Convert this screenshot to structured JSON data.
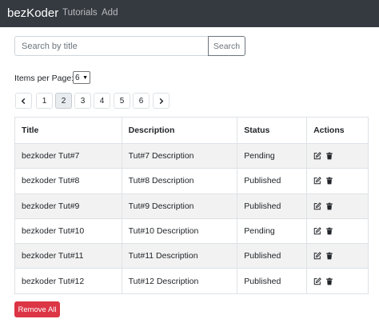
{
  "navbar": {
    "brand": "bezKoder",
    "links": [
      "Tutorials",
      "Add"
    ],
    "bg_color": "#343a40"
  },
  "search": {
    "placeholder": "Search by title",
    "value": "",
    "button_label": "Search"
  },
  "items_per_page": {
    "label": "Items per Page:",
    "selected": "6"
  },
  "pagination": {
    "prev_icon": "chevron-left-icon",
    "next_icon": "chevron-right-icon",
    "pages": [
      "1",
      "2",
      "3",
      "4",
      "5",
      "6"
    ],
    "active_page": "2"
  },
  "table": {
    "headers": [
      "Title",
      "Description",
      "Status",
      "Actions"
    ],
    "rows": [
      {
        "title": "bezkoder Tut#7",
        "description": "Tut#7 Description",
        "status": "Pending"
      },
      {
        "title": "bezkoder Tut#8",
        "description": "Tut#8 Description",
        "status": "Published"
      },
      {
        "title": "bezkoder Tut#9",
        "description": "Tut#9 Description",
        "status": "Published"
      },
      {
        "title": "bezkoder Tut#10",
        "description": "Tut#10 Description",
        "status": "Pending"
      },
      {
        "title": "bezkoder Tut#11",
        "description": "Tut#11 Description",
        "status": "Published"
      },
      {
        "title": "bezkoder Tut#12",
        "description": "Tut#12 Description",
        "status": "Published"
      }
    ],
    "row_action_icons": [
      "edit-icon",
      "trash-icon"
    ]
  },
  "remove_all": {
    "label": "Remove All",
    "color": "#dc3545"
  }
}
